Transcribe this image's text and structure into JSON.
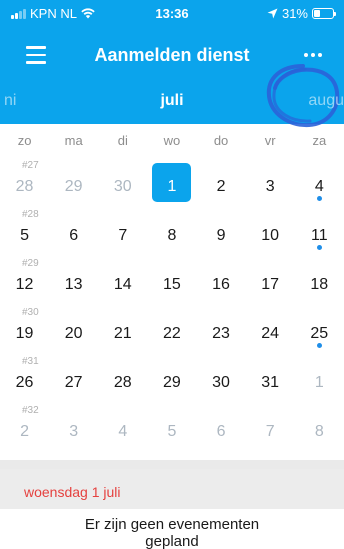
{
  "status_bar": {
    "carrier": "KPN NL",
    "time": "13:36",
    "battery": "31%"
  },
  "header": {
    "title": "Aanmelden dienst"
  },
  "month_nav": {
    "prev": "ni",
    "current": "juli",
    "next": "augu"
  },
  "weekdays": [
    "zo",
    "ma",
    "di",
    "wo",
    "do",
    "vr",
    "za"
  ],
  "weeks": [
    {
      "label": "#27",
      "days": [
        {
          "n": "28",
          "muted": true,
          "dot": false,
          "selected": false
        },
        {
          "n": "29",
          "muted": true,
          "dot": false,
          "selected": false
        },
        {
          "n": "30",
          "muted": true,
          "dot": false,
          "selected": false
        },
        {
          "n": "1",
          "muted": false,
          "dot": false,
          "selected": true
        },
        {
          "n": "2",
          "muted": false,
          "dot": false,
          "selected": false
        },
        {
          "n": "3",
          "muted": false,
          "dot": false,
          "selected": false
        },
        {
          "n": "4",
          "muted": false,
          "dot": true,
          "selected": false
        }
      ]
    },
    {
      "label": "#28",
      "days": [
        {
          "n": "5",
          "muted": false,
          "dot": false,
          "selected": false
        },
        {
          "n": "6",
          "muted": false,
          "dot": false,
          "selected": false
        },
        {
          "n": "7",
          "muted": false,
          "dot": false,
          "selected": false
        },
        {
          "n": "8",
          "muted": false,
          "dot": false,
          "selected": false
        },
        {
          "n": "9",
          "muted": false,
          "dot": false,
          "selected": false
        },
        {
          "n": "10",
          "muted": false,
          "dot": false,
          "selected": false
        },
        {
          "n": "11",
          "muted": false,
          "dot": true,
          "selected": false
        }
      ]
    },
    {
      "label": "#29",
      "days": [
        {
          "n": "12",
          "muted": false,
          "dot": false,
          "selected": false
        },
        {
          "n": "13",
          "muted": false,
          "dot": false,
          "selected": false
        },
        {
          "n": "14",
          "muted": false,
          "dot": false,
          "selected": false
        },
        {
          "n": "15",
          "muted": false,
          "dot": false,
          "selected": false
        },
        {
          "n": "16",
          "muted": false,
          "dot": false,
          "selected": false
        },
        {
          "n": "17",
          "muted": false,
          "dot": false,
          "selected": false
        },
        {
          "n": "18",
          "muted": false,
          "dot": false,
          "selected": false
        }
      ]
    },
    {
      "label": "#30",
      "days": [
        {
          "n": "19",
          "muted": false,
          "dot": false,
          "selected": false
        },
        {
          "n": "20",
          "muted": false,
          "dot": false,
          "selected": false
        },
        {
          "n": "21",
          "muted": false,
          "dot": false,
          "selected": false
        },
        {
          "n": "22",
          "muted": false,
          "dot": false,
          "selected": false
        },
        {
          "n": "23",
          "muted": false,
          "dot": false,
          "selected": false
        },
        {
          "n": "24",
          "muted": false,
          "dot": false,
          "selected": false
        },
        {
          "n": "25",
          "muted": false,
          "dot": true,
          "selected": false
        }
      ]
    },
    {
      "label": "#31",
      "days": [
        {
          "n": "26",
          "muted": false,
          "dot": false,
          "selected": false
        },
        {
          "n": "27",
          "muted": false,
          "dot": false,
          "selected": false
        },
        {
          "n": "28",
          "muted": false,
          "dot": false,
          "selected": false
        },
        {
          "n": "29",
          "muted": false,
          "dot": false,
          "selected": false
        },
        {
          "n": "30",
          "muted": false,
          "dot": false,
          "selected": false
        },
        {
          "n": "31",
          "muted": false,
          "dot": false,
          "selected": false
        },
        {
          "n": "1",
          "muted": true,
          "dot": false,
          "selected": false
        }
      ]
    },
    {
      "label": "#32",
      "days": [
        {
          "n": "2",
          "muted": true,
          "dot": false,
          "selected": false
        },
        {
          "n": "3",
          "muted": true,
          "dot": false,
          "selected": false
        },
        {
          "n": "4",
          "muted": true,
          "dot": false,
          "selected": false
        },
        {
          "n": "5",
          "muted": true,
          "dot": false,
          "selected": false
        },
        {
          "n": "6",
          "muted": true,
          "dot": false,
          "selected": false
        },
        {
          "n": "7",
          "muted": true,
          "dot": false,
          "selected": false
        },
        {
          "n": "8",
          "muted": true,
          "dot": false,
          "selected": false
        }
      ]
    }
  ],
  "selected_day_label": "woensdag 1 juli",
  "empty_message": {
    "line1": "Er zijn geen evenementen",
    "line2": "gepland"
  },
  "colors": {
    "accent": "#0ba4ec",
    "event_dot": "#1f8ee8",
    "selected_day_text": "#e5413f",
    "scribble": "#2a63d9"
  },
  "icons": {
    "menu": "hamburger-icon",
    "more": "more-dots-icon",
    "wifi": "wifi-icon",
    "location": "location-arrow-icon",
    "battery": "battery-icon"
  }
}
